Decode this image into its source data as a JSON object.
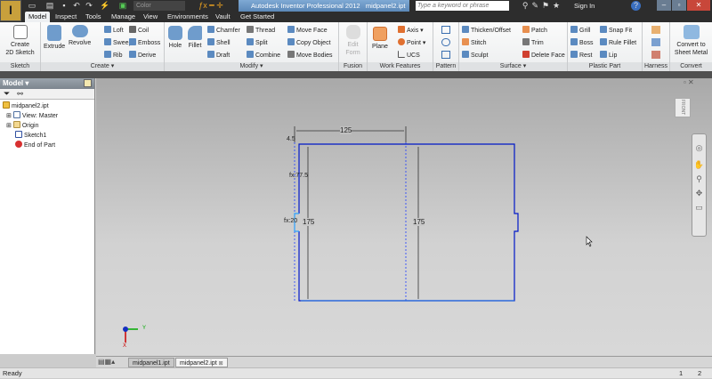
{
  "app": {
    "title": "Autodesk Inventor Professional 2012",
    "document": "midpanel2.ipt",
    "logo": "I",
    "edition": "PRO"
  },
  "quick_access": {
    "color_select": "Color",
    "search_placeholder": "Type a keyword or phrase",
    "sign_in": "Sign In",
    "help": "?"
  },
  "tabs": [
    "Model",
    "Inspect",
    "Tools",
    "Manage",
    "View",
    "Environments",
    "Vault",
    "Get Started"
  ],
  "ribbon": {
    "sketch": {
      "label": "Sketch",
      "create": "Create\n2D Sketch"
    },
    "create": {
      "label": "Create ▾",
      "extrude": "Extrude",
      "revolve": "Revolve",
      "loft": "Loft",
      "sweep": "Sweep",
      "rib": "Rib",
      "coil": "Coil",
      "emboss": "Emboss",
      "derive": "Derive"
    },
    "modify": {
      "label": "Modify ▾",
      "hole": "Hole",
      "fillet": "Fillet",
      "chamfer": "Chamfer",
      "shell": "Shell",
      "draft": "Draft",
      "thread": "Thread",
      "split": "Split",
      "combine": "Combine",
      "move_face": "Move Face",
      "copy_object": "Copy Object",
      "move_bodies": "Move Bodies"
    },
    "fusion": {
      "label": "Fusion",
      "edit_form": "Edit\nForm"
    },
    "work_features": {
      "label": "Work Features",
      "plane": "Plane",
      "axis": "Axis",
      "point": "Point",
      "ucs": "UCS"
    },
    "pattern": {
      "label": "Pattern"
    },
    "surface": {
      "label": "Surface ▾",
      "thicken": "Thicken/Offset",
      "stitch": "Stitch",
      "sculpt": "Sculpt",
      "patch": "Patch",
      "trim": "Trim",
      "delete_face": "Delete Face"
    },
    "plastic": {
      "label": "Plastic Part",
      "grill": "Grill",
      "boss": "Boss",
      "rest": "Rest",
      "snap_fit": "Snap Fit",
      "rule_fillet": "Rule Fillet",
      "lip": "Lip"
    },
    "harness": {
      "label": "Harness"
    },
    "convert": {
      "label": "Convert",
      "sheet_metal": "Convert to\nSheet Metal"
    }
  },
  "browser": {
    "title": "Model ▾",
    "tree": [
      "midpanel2.ipt",
      "View: Master",
      "Origin",
      "Sketch1",
      "End of Part"
    ]
  },
  "sketch": {
    "dim_width": "125",
    "dim_offset": "4.5",
    "dim_fx1": "fx:77.5",
    "dim_fx2": "fx:20",
    "dim_height_left": "175",
    "dim_height_mid": "175"
  },
  "viewcube": "FRONT",
  "doc_tabs": [
    "midpanel1.ipt",
    "midpanel2.ipt"
  ],
  "status": {
    "text": "Ready",
    "n1": "1",
    "n2": "2"
  },
  "colors": {
    "sketch_line": "#0018c8",
    "projected": "#2aa0ff",
    "accent": "#6b96c6"
  }
}
